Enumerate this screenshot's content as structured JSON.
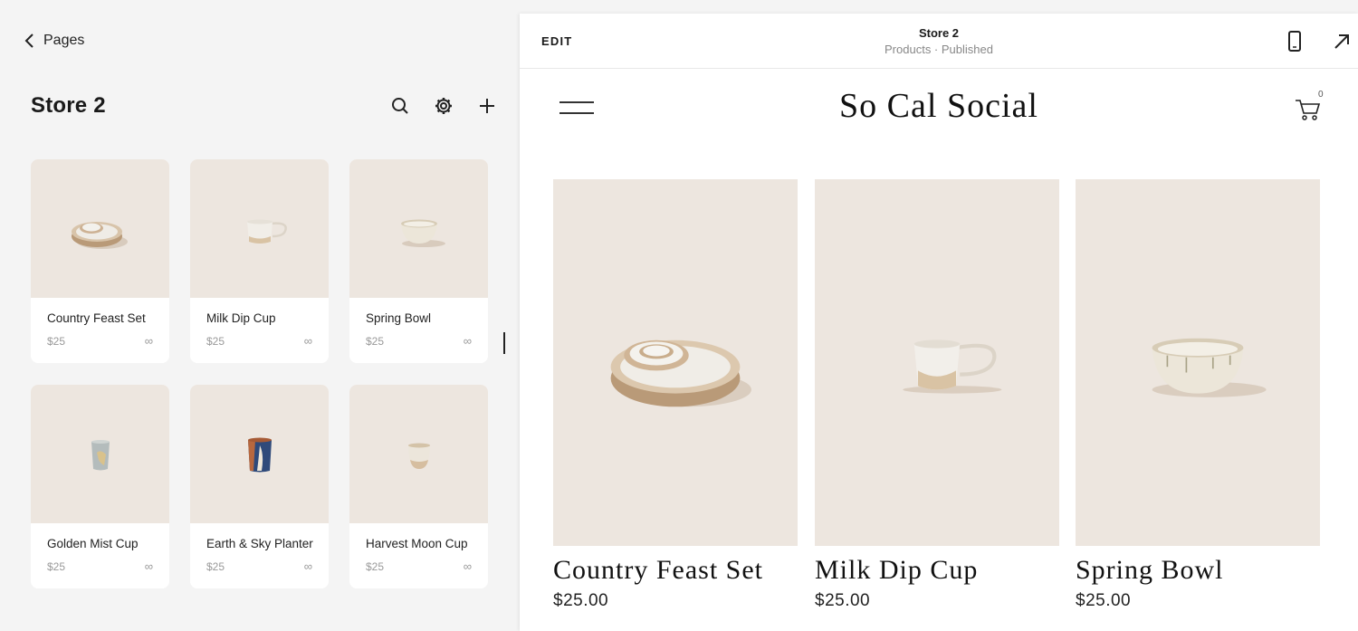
{
  "nav": {
    "back_label": "Pages"
  },
  "panel": {
    "title": "Store 2",
    "tools": [
      "search-icon",
      "gear-icon",
      "plus-icon"
    ]
  },
  "products": [
    {
      "name": "Country Feast Set",
      "price": "$25",
      "stock": "∞"
    },
    {
      "name": "Milk Dip Cup",
      "price": "$25",
      "stock": "∞"
    },
    {
      "name": "Spring Bowl",
      "price": "$25",
      "stock": "∞"
    },
    {
      "name": "Golden Mist Cup",
      "price": "$25",
      "stock": "∞"
    },
    {
      "name": "Earth & Sky Planter",
      "price": "$25",
      "stock": "∞"
    },
    {
      "name": "Harvest Moon Cup",
      "price": "$25",
      "stock": "∞"
    }
  ],
  "preview": {
    "edit_label": "EDIT",
    "page_title": "Store 2",
    "page_subtitle": "Products · Published",
    "site_name": "So Cal Social",
    "cart_count": "0",
    "items": [
      {
        "name": "Country Feast Set",
        "price": "$25.00"
      },
      {
        "name": "Milk Dip Cup",
        "price": "$25.00"
      },
      {
        "name": "Spring Bowl",
        "price": "$25.00"
      }
    ]
  },
  "colors": {
    "thumb_bg": "#ede6df",
    "panel_bg": "#f4f4f4",
    "accent": "#1a1a1a"
  }
}
